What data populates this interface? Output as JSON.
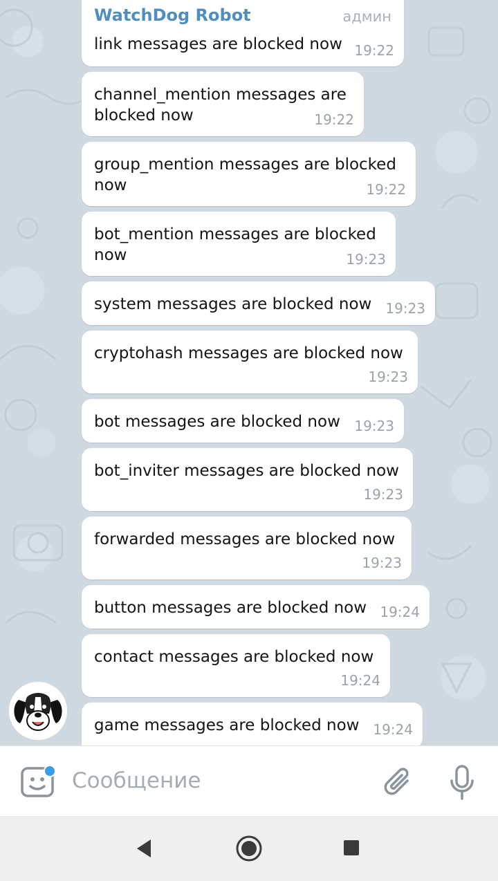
{
  "chat": {
    "sender_name": "WatchDog Robot",
    "sender_role": "админ",
    "messages": [
      {
        "text": "link messages are blocked now",
        "time": "19:22"
      },
      {
        "text": "channel_mention messages are\nblocked now",
        "time": "19:22"
      },
      {
        "text": "group_mention messages are blocked\nnow",
        "time": "19:22"
      },
      {
        "text": "bot_mention messages are blocked\nnow",
        "time": "19:23"
      },
      {
        "text": "system messages are blocked now",
        "time": "19:23"
      },
      {
        "text": "cryptohash messages are blocked now",
        "time": "19:23"
      },
      {
        "text": "bot messages are blocked now",
        "time": "19:23"
      },
      {
        "text": "bot_inviter messages are blocked now",
        "time": "19:23"
      },
      {
        "text": "forwarded messages are blocked now",
        "time": "19:23"
      },
      {
        "text": "button messages are blocked now",
        "time": "19:24"
      },
      {
        "text": "contact messages are blocked now",
        "time": "19:24"
      },
      {
        "text": "game messages are blocked now",
        "time": "19:24"
      }
    ]
  },
  "input": {
    "placeholder": "Сообщение"
  },
  "icons": {
    "sticker": "sticker-icon",
    "attach": "paperclip-icon",
    "mic": "microphone-icon",
    "back": "back-triangle-icon",
    "home": "home-circle-icon",
    "recents": "recents-square-icon"
  },
  "colors": {
    "sender": "#4e8ec1",
    "badge": "#3a9be8",
    "time": "#9aa3ab",
    "wallpaper": "#cfd9e2"
  }
}
